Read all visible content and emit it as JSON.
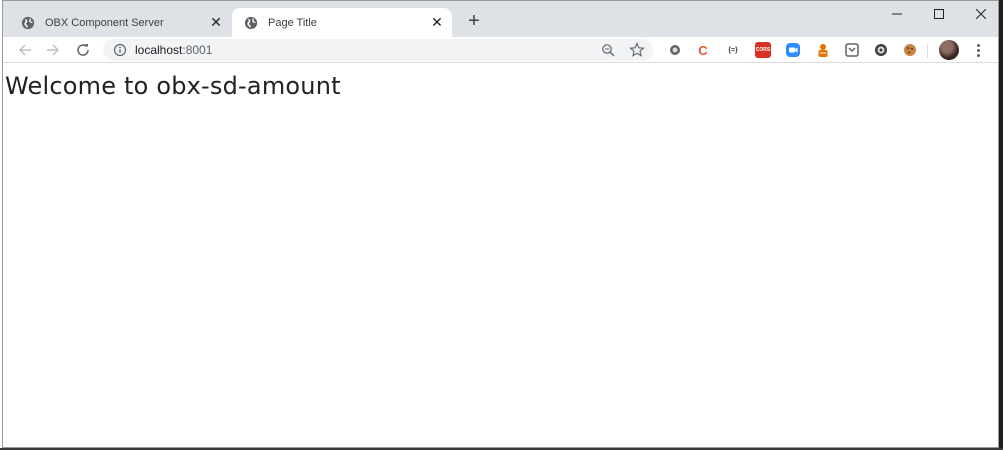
{
  "tabs": [
    {
      "title": "OBX Component Server",
      "active": false,
      "icon": "globe-icon"
    },
    {
      "title": "Page Title",
      "active": true,
      "icon": "globe-icon"
    }
  ],
  "address_bar": {
    "host": "localhost",
    "port": ":8001"
  },
  "extensions": [
    {
      "name": "circle-extension-icon",
      "color": "#5f6368"
    },
    {
      "name": "c-extension-icon",
      "label": "C",
      "color": "#e8542f"
    },
    {
      "name": "json-extension-icon",
      "label": "{=}",
      "color": "#3c4043"
    },
    {
      "name": "cors-extension-icon",
      "label": "CORS",
      "color": "#d93025"
    },
    {
      "name": "zoom-extension-icon",
      "color": "#2d8cff"
    },
    {
      "name": "person-extension-icon",
      "color": "#e37400"
    },
    {
      "name": "pocket-extension-icon",
      "color": "#5f6368"
    },
    {
      "name": "shield-extension-icon",
      "color": "#3c4043"
    },
    {
      "name": "cookie-extension-icon",
      "color": "#a0522d"
    }
  ],
  "page": {
    "heading": "Welcome to obx-sd-amount"
  }
}
